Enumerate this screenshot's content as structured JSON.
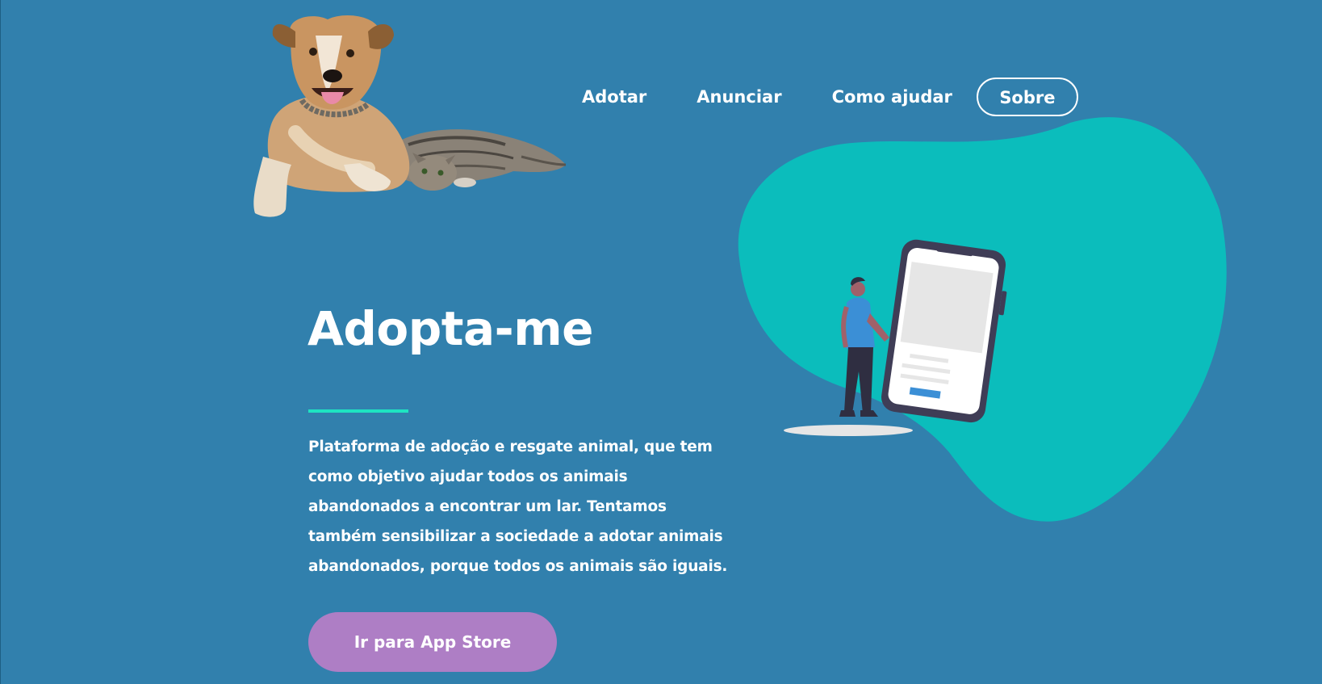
{
  "site": {
    "logo_image": "dog-and-cat-photo"
  },
  "nav": {
    "items": [
      {
        "label": "Adotar"
      },
      {
        "label": "Anunciar"
      },
      {
        "label": "Como ajudar"
      }
    ],
    "about_button_label": "Sobre"
  },
  "hero": {
    "title": "Adopta-me",
    "description": "Plataforma de adoção e resgate animal, que tem como objetivo ajudar todos os animais abandonados a encontrar um lar. Tentamos também sensibilizar a sociedade a adotar animais abandonados, porque todos os animais são iguais.",
    "cta_label": "Ir para App Store",
    "illustration": "person-with-smartphone-illustration"
  },
  "colors": {
    "background": "#3180ad",
    "blob": "#0bbdbc",
    "underline": "#1ee4c2",
    "cta": "#ae7ec5",
    "text": "#ffffff"
  }
}
